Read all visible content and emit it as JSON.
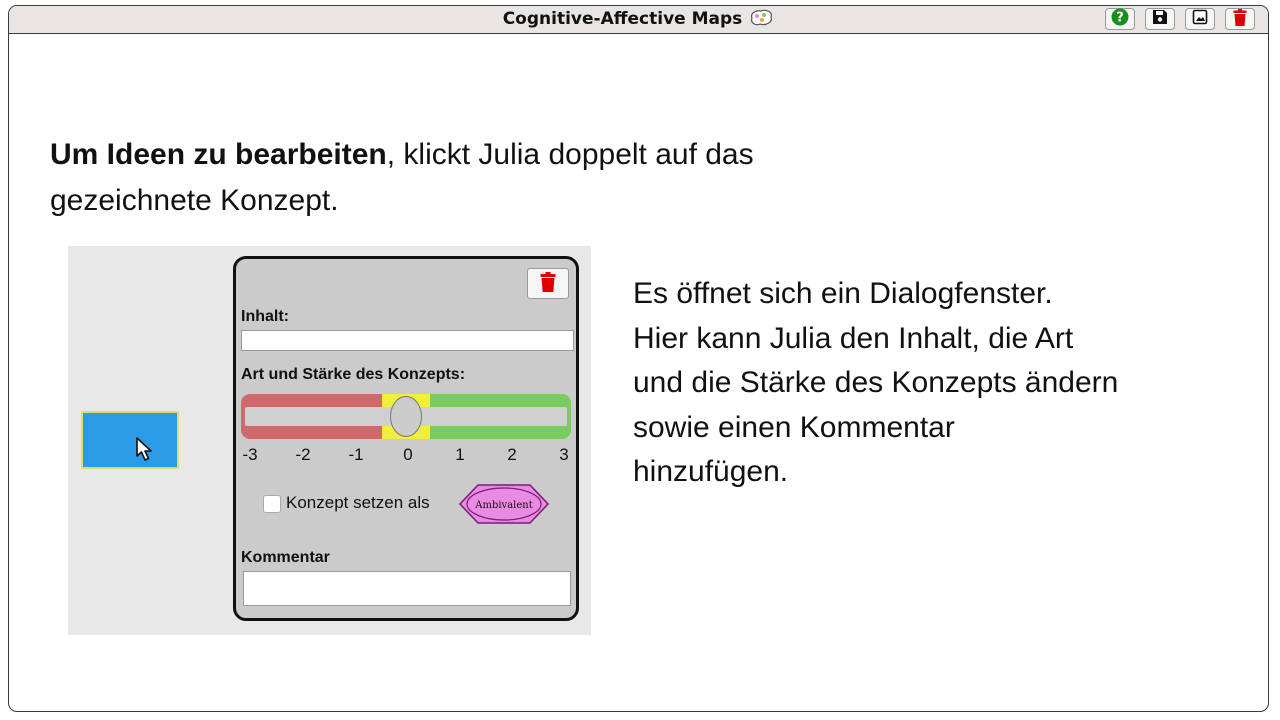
{
  "window": {
    "title": "Cognitive-Affective Maps",
    "buttons": {
      "help_icon": "help-icon",
      "save_icon": "save-icon",
      "image_icon": "image-icon",
      "delete_icon": "trash-icon"
    }
  },
  "intro": {
    "bold": "Um Ideen zu bearbeiten",
    "rest_line1": ", klickt Julia doppelt auf das",
    "line2": "gezeichnete Konzept."
  },
  "description": {
    "lines": [
      "Es öffnet sich ein Dialogfenster.",
      "Hier kann Julia den Inhalt, die Art",
      "und die Stärke des Konzepts ändern",
      "sowie einen Kommentar",
      "hinzufügen."
    ]
  },
  "dialog": {
    "content_label": "Inhalt:",
    "content_value": "",
    "type_strength_label": "Art und Stärke des Konzepts:",
    "slider": {
      "ticks": [
        "-3",
        "-2",
        "-1",
        "0",
        "1",
        "2",
        "3"
      ],
      "value": 0,
      "colors": {
        "negative": "#d0696a",
        "neutral": "#f0ef3c",
        "positive": "#79cc5f"
      }
    },
    "set_concept_label": "Konzept setzen als",
    "set_concept_checked": false,
    "ambivalent_label": "Ambivalent",
    "comment_label": "Kommentar",
    "comment_value": ""
  },
  "colors": {
    "concept_box": "#2a9be4",
    "concept_border": "#d9e06a",
    "ambivalent_fill": "#e98ae3",
    "ambivalent_stroke": "#7a1a7a",
    "delete_red": "#e00000",
    "help_green": "#1a8f1a"
  }
}
